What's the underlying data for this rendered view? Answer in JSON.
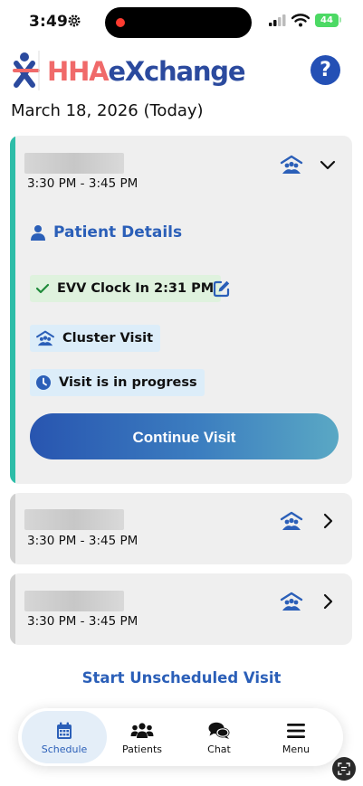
{
  "status_bar": {
    "time": "3:49",
    "battery": "44"
  },
  "header": {
    "logo_hha": "HHA",
    "logo_exchange": "eXchange",
    "help_label": "?"
  },
  "date_heading": "March 18, 2026 (Today)",
  "visits": [
    {
      "time": "3:30 PM - 3:45 PM",
      "expanded": true,
      "patient_details_label": "Patient Details",
      "evv_clock_in": "EVV Clock In 2:31 PM",
      "cluster_visit": "Cluster Visit",
      "visit_status": "Visit is in progress",
      "continue_label": "Continue Visit"
    },
    {
      "time": "3:30 PM - 3:45 PM",
      "expanded": false
    },
    {
      "time": "3:30 PM - 3:45 PM",
      "expanded": false
    }
  ],
  "start_unscheduled_label": "Start Unscheduled Visit",
  "bottom_nav": {
    "items": [
      {
        "label": "Schedule",
        "icon": "calendar-icon",
        "active": true
      },
      {
        "label": "Patients",
        "icon": "people-icon",
        "active": false
      },
      {
        "label": "Chat",
        "icon": "chat-icon",
        "active": false
      },
      {
        "label": "Menu",
        "icon": "hamburger-menu-icon",
        "active": false
      }
    ]
  },
  "colors": {
    "primary_blue": "#2b5fb8",
    "accent_teal": "#2dbda8",
    "logo_red": "#f06a6a",
    "evv_chip_bg": "#dff2de",
    "info_chip_bg": "#dcedf9"
  }
}
